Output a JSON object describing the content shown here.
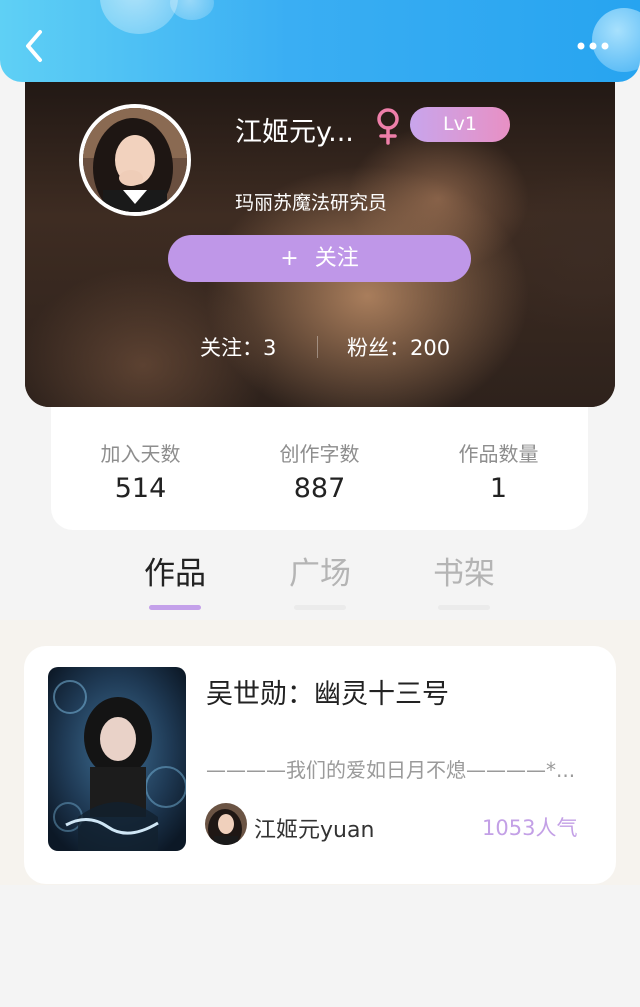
{
  "colors": {
    "header_gradient_start": "#5fd0f5",
    "header_gradient_end": "#27a4f0",
    "accent_purple": "#bf97e8",
    "level_badge_start": "#c8a5ec",
    "level_badge_end": "#e890c4",
    "gender_icon": "#ee7fa9",
    "popularity_text": "#c3a0e6",
    "page_background": "#f4f4f4"
  },
  "header": {
    "back_icon": "chevron-left-icon",
    "more_icon": "more-horizontal-icon"
  },
  "profile": {
    "name": "江姬元y...",
    "gender_icon": "female-icon",
    "level": "Lv1",
    "title": "玛丽苏魔法研究员",
    "follow_button": {
      "plus": "+",
      "label": "关注"
    },
    "following_text": "关注：3",
    "fans_text": "粉丝：200"
  },
  "stats": [
    {
      "label": "加入天数",
      "value": "514"
    },
    {
      "label": "创作字数",
      "value": "887"
    },
    {
      "label": "作品数量",
      "value": "1"
    }
  ],
  "tabs": [
    {
      "label": "作品",
      "active": true
    },
    {
      "label": "广场",
      "active": false
    },
    {
      "label": "书架",
      "active": false
    }
  ],
  "works": [
    {
      "title": "吴世勋：幽灵十三号",
      "summary": "————我们的爱如日月不熄————*...",
      "author": "江姬元yuan",
      "popularity": "1053人气"
    }
  ]
}
